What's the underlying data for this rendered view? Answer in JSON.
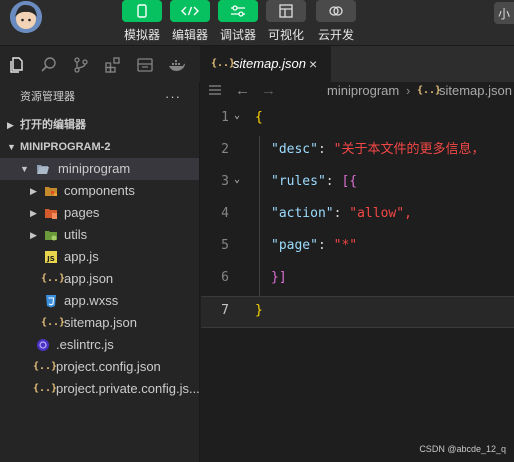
{
  "toolbar": {
    "buttons": [
      {
        "label": "模拟器",
        "icon": "phone-icon"
      },
      {
        "label": "编辑器",
        "icon": "code-icon"
      },
      {
        "label": "调试器",
        "icon": "sliders-icon"
      },
      {
        "label": "可视化",
        "icon": "layout-icon"
      },
      {
        "label": "云开发",
        "icon": "cloud-icon"
      }
    ],
    "user_chip": "小",
    "accent": "#07c160"
  },
  "explorer": {
    "title": "资源管理器",
    "more": "···",
    "open_editors": "打开的编辑器",
    "project": "MINIPROGRAM-2",
    "tree": [
      {
        "label": "miniprogram",
        "type": "folder-open"
      },
      {
        "label": "components",
        "type": "folder"
      },
      {
        "label": "pages",
        "type": "folder"
      },
      {
        "label": "utils",
        "type": "folder"
      },
      {
        "label": "app.js",
        "type": "js"
      },
      {
        "label": "app.json",
        "type": "json"
      },
      {
        "label": "app.wxss",
        "type": "css"
      },
      {
        "label": "sitemap.json",
        "type": "json"
      },
      {
        "label": ".eslintrc.js",
        "type": "eslint"
      },
      {
        "label": "project.config.json",
        "type": "json"
      },
      {
        "label": "project.private.config.js...",
        "type": "json"
      }
    ]
  },
  "editor": {
    "tab_label": "sitemap.json",
    "tab_icon": "{..}",
    "tab_close": "×",
    "breadcrumbs": [
      "miniprogram",
      "sitemap.json"
    ],
    "lines": [
      {
        "n": "1",
        "text": "{"
      },
      {
        "n": "2",
        "key": "\"desc\"",
        "value": "\"关于本文件的更多信息，"
      },
      {
        "n": "3",
        "key": "\"rules\"",
        "rest": "[{"
      },
      {
        "n": "4",
        "key": "\"action\"",
        "value": "\"allow\","
      },
      {
        "n": "5",
        "key": "\"page\"",
        "value": "\"*\""
      },
      {
        "n": "6",
        "text": "}]"
      },
      {
        "n": "7",
        "text": "}"
      }
    ]
  },
  "watermark": "CSDN @abcde_12_q"
}
